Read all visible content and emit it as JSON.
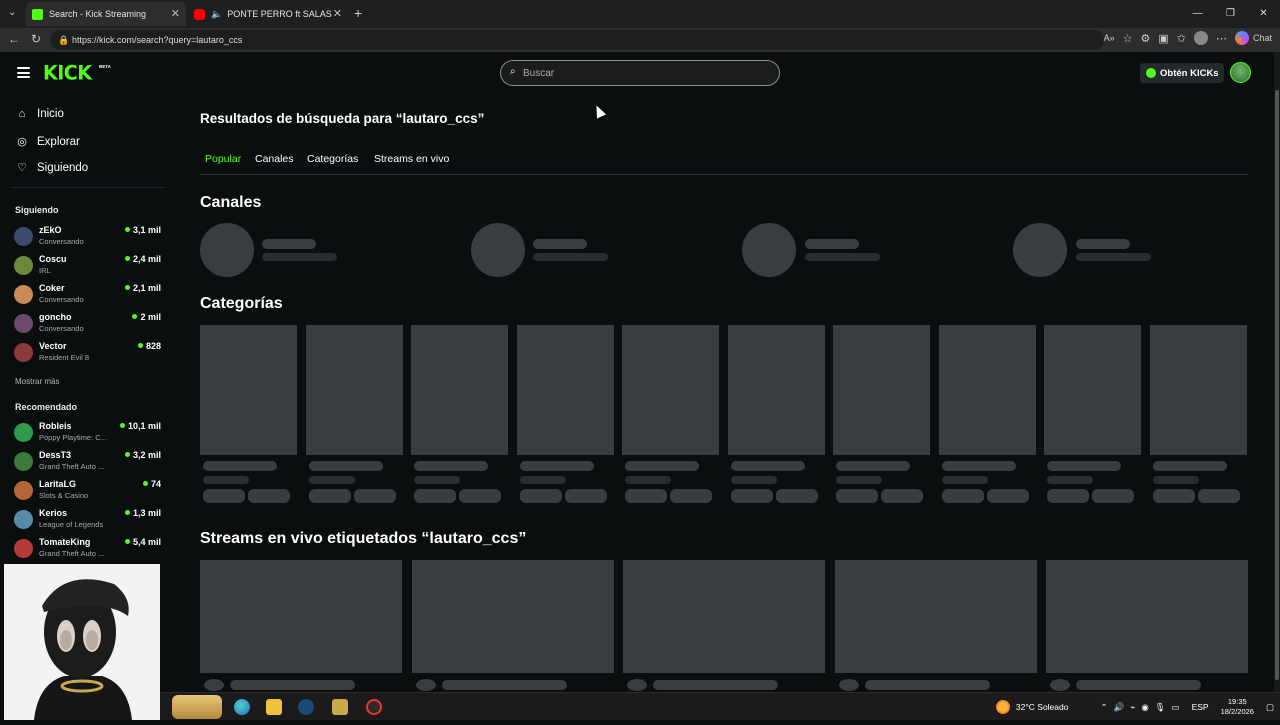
{
  "browser": {
    "tabs": [
      {
        "title": "Search - Kick Streaming",
        "active": true,
        "favicon_color": "#53fc18"
      },
      {
        "title": "PONTE PERRO ft SALASTKBR…",
        "active": false,
        "favicon_color": "#ff0000"
      }
    ],
    "url": "https://kick.com/search?query=lautaro_ccs",
    "chat_label": "Chat"
  },
  "header": {
    "logo": "KICK",
    "beta_badge": "BETA",
    "search_placeholder": "Buscar",
    "get_kicks_label": "Obtén KICKs"
  },
  "sidebar": {
    "nav": [
      {
        "label": "Inicio",
        "icon": "home-icon"
      },
      {
        "label": "Explorar",
        "icon": "compass-icon"
      },
      {
        "label": "Siguiendo",
        "icon": "heart-icon"
      }
    ],
    "following_title": "Siguiendo",
    "following": [
      {
        "name": "zEkO",
        "category": "Conversando",
        "viewers": "3,1 mil",
        "color": "#3a4a6a"
      },
      {
        "name": "Coscu",
        "category": "IRL",
        "viewers": "2,4 mil",
        "color": "#6a8a3a"
      },
      {
        "name": "Coker",
        "category": "Conversando",
        "viewers": "2,1 mil",
        "color": "#c98a55"
      },
      {
        "name": "goncho",
        "category": "Conversando",
        "viewers": "2 mil",
        "color": "#6a4a6a"
      },
      {
        "name": "Vector",
        "category": "Resident Evil 8",
        "viewers": "828",
        "color": "#8a3a3a"
      }
    ],
    "show_more": "Mostrar más",
    "recommended_title": "Recomendado",
    "recommended": [
      {
        "name": "Robleis",
        "category": "Poppy Playtime: C...",
        "viewers": "10,1 mil",
        "color": "#2e9a4a"
      },
      {
        "name": "DessT3",
        "category": "Grand Theft Auto ...",
        "viewers": "3,2 mil",
        "color": "#3a7a3a"
      },
      {
        "name": "LaritaLG",
        "category": "Slots & Casino",
        "viewers": "74",
        "color": "#b5653a"
      },
      {
        "name": "Kerios",
        "category": "League of Legends",
        "viewers": "1,3 mil",
        "color": "#5a8aaa"
      },
      {
        "name": "TomateKing",
        "category": "Grand Theft Auto ...",
        "viewers": "5,4 mil",
        "color": "#b53a3a"
      }
    ]
  },
  "main": {
    "heading": "Resultados de búsqueda para “lautaro_ccs”",
    "tabs": [
      "Popular",
      "Canales",
      "Categorías",
      "Streams en vivo"
    ],
    "active_tab": "Popular",
    "channels_title": "Canales",
    "categories_title": "Categorías",
    "streams_title": "Streams en vivo etiquetados “lautaro_ccs”"
  },
  "taskbar": {
    "weather": "32°C  Soleado",
    "lang": "ESP",
    "time": "19:35",
    "date": "18/2/2026"
  },
  "colors": {
    "accent": "#53fc18",
    "background": "#0b0e0f",
    "skeleton": "#3a3d40"
  }
}
